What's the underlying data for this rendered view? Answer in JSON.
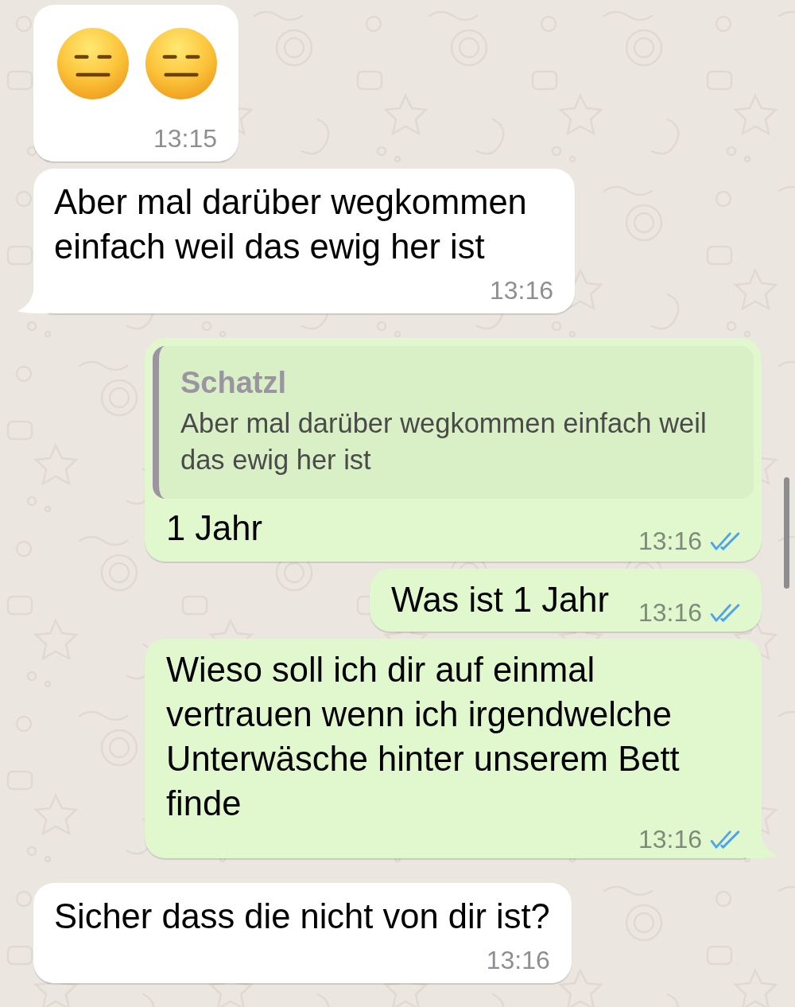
{
  "chat": {
    "messages": [
      {
        "outgoing": false,
        "kind": "emoji",
        "emojis": [
          {
            "kind": "expressionless"
          },
          {
            "kind": "expressionless"
          }
        ],
        "time": "13:15",
        "tail": false
      },
      {
        "outgoing": false,
        "kind": "text",
        "text": "Aber mal darüber wegkommen einfach weil das ewig her ist",
        "time": "13:16",
        "tail": true
      },
      {
        "outgoing": true,
        "kind": "reply",
        "quote": {
          "author": "Schatzl",
          "text": "Aber mal darüber wegkommen einfach weil das ewig her ist"
        },
        "text": "1 Jahr",
        "time": "13:16",
        "read": true,
        "tail": false
      },
      {
        "outgoing": true,
        "kind": "text",
        "text": "Was ist 1 Jahr",
        "time": "13:16",
        "read": true,
        "tail": false
      },
      {
        "outgoing": true,
        "kind": "text",
        "text": "Wieso soll ich dir auf einmal vertrauen wenn ich irgendwelche Unterwäsche hinter unserem Bett finde",
        "time": "13:16",
        "read": true,
        "tail": true
      },
      {
        "outgoing": false,
        "kind": "text",
        "text": "Sicher dass die nicht von dir ist?",
        "time": "13:16",
        "tail": false
      }
    ]
  }
}
